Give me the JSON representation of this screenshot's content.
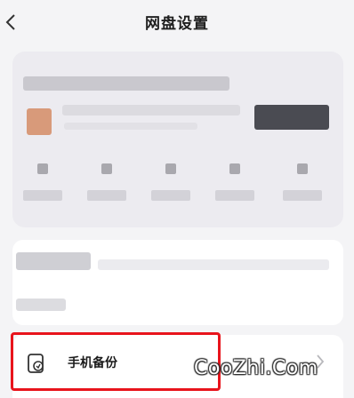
{
  "header": {
    "title": "网盘设置",
    "back_icon": "chevron-left-icon"
  },
  "settings": {
    "backup_label": "手机备份",
    "backup_icon": "phone-backup-icon",
    "chevron_icon": "chevron-right-icon"
  },
  "watermark": {
    "text": "CooZhi.Com"
  },
  "colors": {
    "highlight": "#e8141c",
    "background": "#f4f4f6"
  }
}
